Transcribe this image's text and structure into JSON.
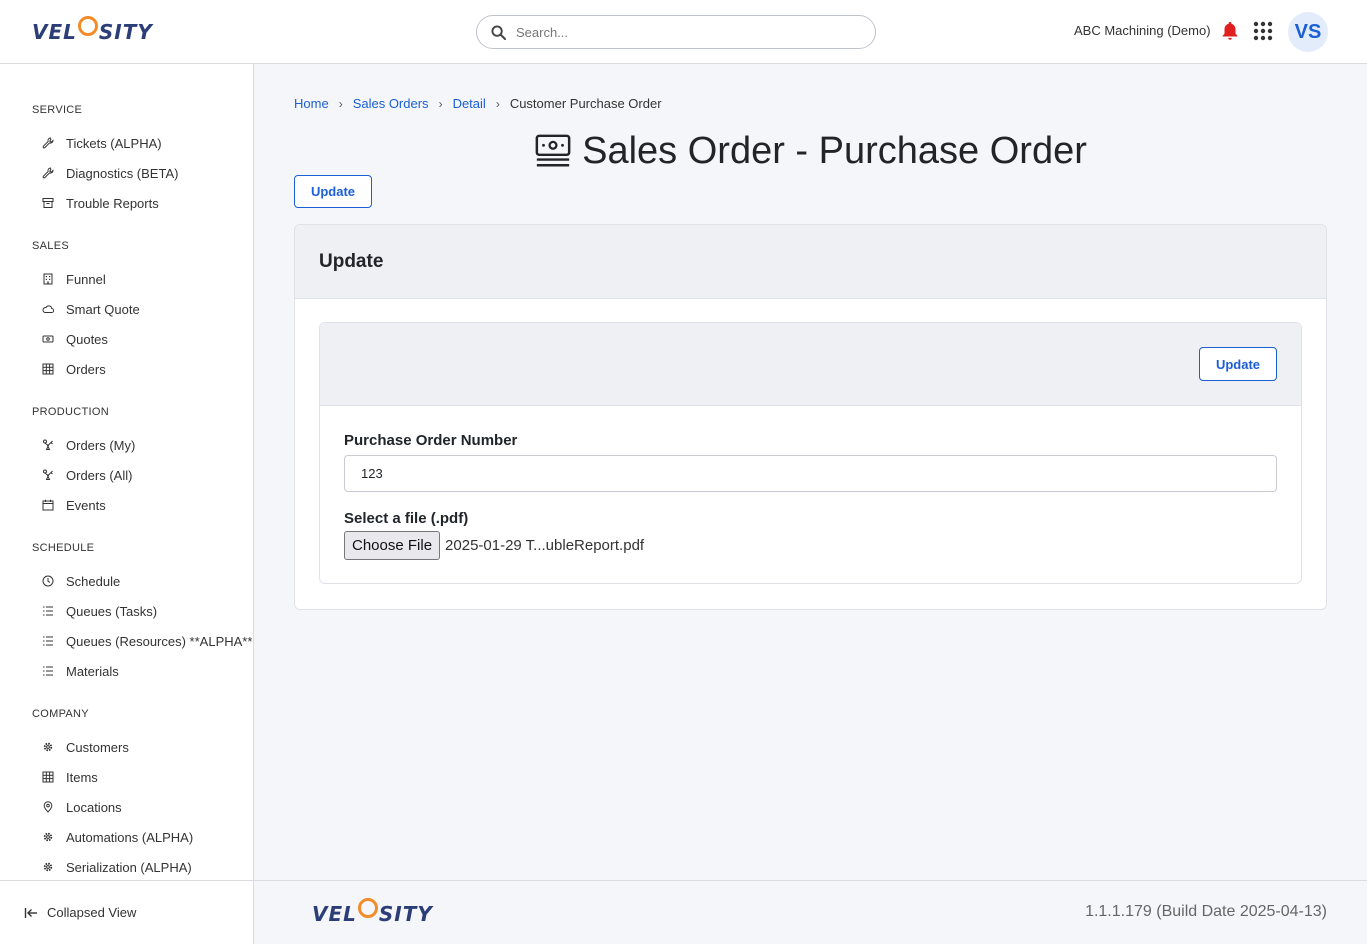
{
  "header": {
    "logo_text_left": "VEL",
    "logo_text_right": "SITY",
    "search_placeholder": "Search...",
    "company": "ABC Machining (Demo)",
    "avatar_initials": "VS"
  },
  "sidebar": {
    "sections": [
      {
        "title": "SERVICE",
        "items": [
          {
            "label": "Tickets (ALPHA)",
            "icon": "wrench-icon"
          },
          {
            "label": "Diagnostics (BETA)",
            "icon": "wrench-icon"
          },
          {
            "label": "Trouble Reports",
            "icon": "archive-icon"
          }
        ]
      },
      {
        "title": "SALES",
        "items": [
          {
            "label": "Funnel",
            "icon": "building-icon"
          },
          {
            "label": "Smart Quote",
            "icon": "cloud-icon"
          },
          {
            "label": "Quotes",
            "icon": "money-icon"
          },
          {
            "label": "Orders",
            "icon": "table-icon"
          }
        ]
      },
      {
        "title": "PRODUCTION",
        "items": [
          {
            "label": "Orders (My)",
            "icon": "robot-arm-icon"
          },
          {
            "label": "Orders (All)",
            "icon": "robot-arm-icon"
          },
          {
            "label": "Events",
            "icon": "calendar-icon"
          }
        ]
      },
      {
        "title": "SCHEDULE",
        "items": [
          {
            "label": "Schedule",
            "icon": "clock-icon"
          },
          {
            "label": "Queues (Tasks)",
            "icon": "list-icon"
          },
          {
            "label": "Queues (Resources) **ALPHA**",
            "icon": "list-icon"
          },
          {
            "label": "Materials",
            "icon": "list-icon"
          }
        ]
      },
      {
        "title": "COMPANY",
        "items": [
          {
            "label": "Customers",
            "icon": "gear-icon"
          },
          {
            "label": "Items",
            "icon": "table-icon"
          },
          {
            "label": "Locations",
            "icon": "pin-icon"
          },
          {
            "label": "Automations (ALPHA)",
            "icon": "gear-icon"
          },
          {
            "label": "Serialization (ALPHA)",
            "icon": "gear-icon"
          }
        ]
      }
    ],
    "collapse_label": "Collapsed View"
  },
  "breadcrumb": {
    "items": [
      "Home",
      "Sales Orders",
      "Detail"
    ],
    "current": "Customer Purchase Order"
  },
  "page": {
    "title": "Sales Order - Purchase Order",
    "top_button": "Update",
    "card_title": "Update",
    "inner_button": "Update",
    "po_label": "Purchase Order Number",
    "po_value": "123",
    "file_label": "Select a file (.pdf)",
    "file_button": "Choose File",
    "file_name": "2025-01-29 T...ubleReport.pdf"
  },
  "footer": {
    "version": "1.1.1.179 (Build Date 2025-04-13)"
  },
  "colors": {
    "accent": "#1a5fd6",
    "logo_orange": "#f28c28",
    "logo_navy": "#2c3e78",
    "bell": "#e0201f"
  }
}
